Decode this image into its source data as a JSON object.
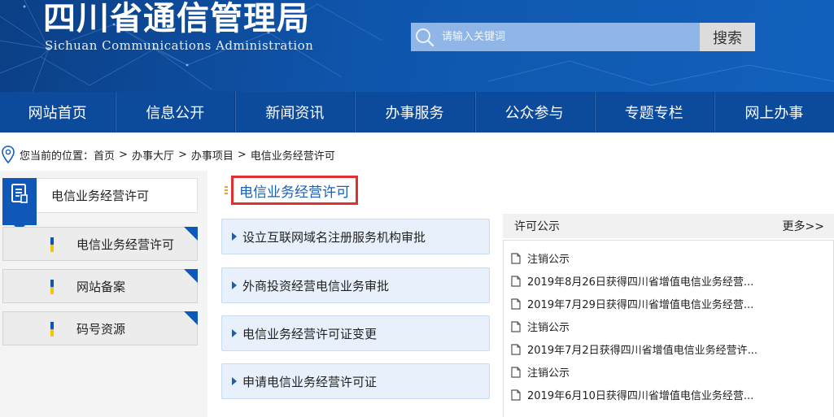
{
  "header": {
    "title": "四川省通信管理局",
    "subtitle": "Sichuan Communications Administration",
    "search_placeholder": "请输入关键词",
    "search_button": "搜索"
  },
  "nav": {
    "items": [
      "网站首页",
      "信息公开",
      "新闻资讯",
      "办事服务",
      "公众参与",
      "专题专栏",
      "网上办事"
    ]
  },
  "breadcrumb": {
    "prefix": "您当前的位置：",
    "items": [
      "首页",
      "办事大厅",
      "办事项目",
      "电信业务经营许可"
    ],
    "separator": ">"
  },
  "sidebar": {
    "heading": "电信业务经营许可",
    "items": [
      "电信业务经营许可",
      "网站备案",
      "码号资源"
    ]
  },
  "content": {
    "title": "电信业务经营许可",
    "services": [
      "设立互联网域名注册服务机构审批",
      "外商投资经营电信业务审批",
      "电信业务经营许可证变更",
      "申请电信业务经营许可证"
    ]
  },
  "notice": {
    "title": "许可公示",
    "more": "更多>>",
    "items": [
      "注销公示",
      "2019年8月26日获得四川省增值电信业务经营...",
      "2019年7月29日获得四川省增值电信业务经营...",
      "注销公示",
      "2019年7月2日获得四川省增值电信业务经营许...",
      "注销公示",
      "2019年6月10日获得四川省增值电信业务经营..."
    ]
  },
  "colors": {
    "header_bg": "#0f56ad",
    "nav_bg": "#0c4a9c",
    "accent_blue": "#1058b7",
    "highlight_red": "#e03030",
    "service_bg": "#e8f1fb"
  }
}
